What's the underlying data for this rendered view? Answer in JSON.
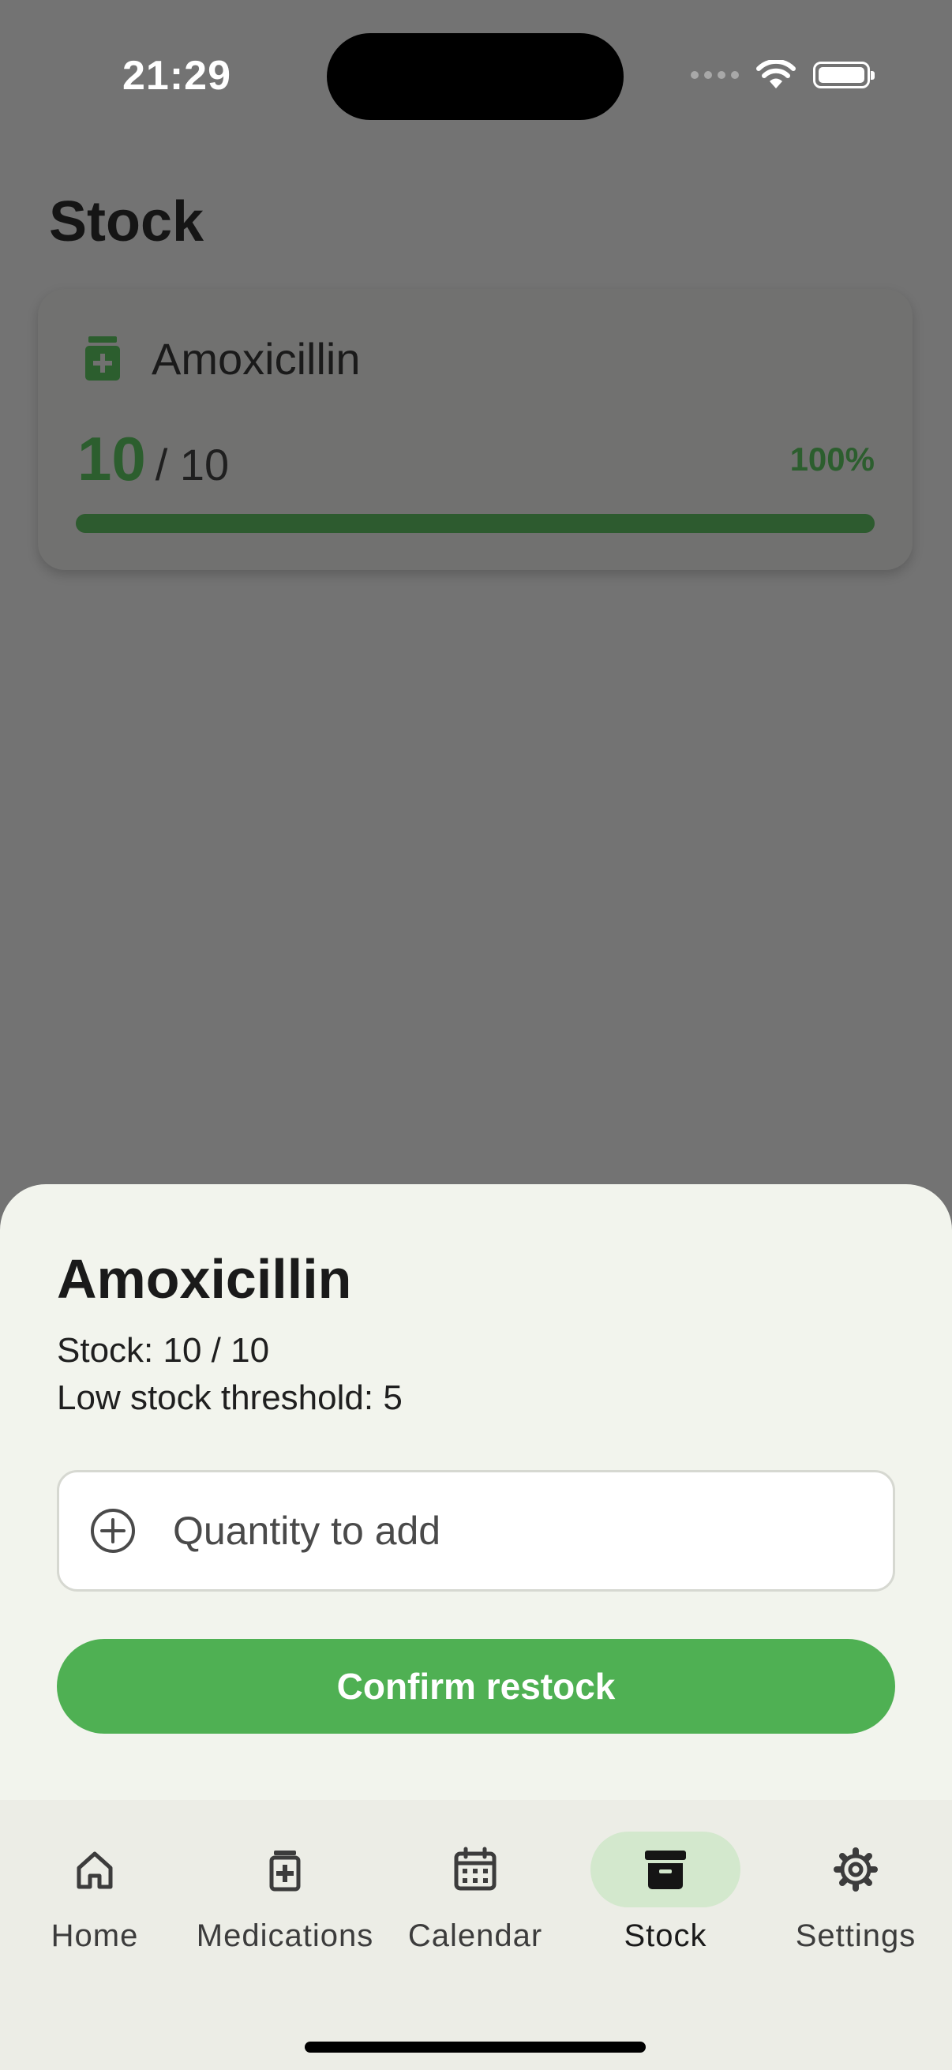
{
  "status_bar": {
    "time": "21:29"
  },
  "page": {
    "title": "Stock"
  },
  "stock_card": {
    "name": "Amoxicillin",
    "current": "10",
    "total": "/ 10",
    "percent_label": "100%",
    "fill_fraction": 1.0
  },
  "sheet": {
    "title": "Amoxicillin",
    "stock_line": "Stock: 10 / 10",
    "threshold_line": "Low stock threshold: 5",
    "quantity_placeholder": "Quantity to add",
    "confirm_label": "Confirm restock"
  },
  "nav": {
    "items": [
      {
        "label": "Home",
        "icon": "home-icon"
      },
      {
        "label": "Medications",
        "icon": "medication-icon"
      },
      {
        "label": "Calendar",
        "icon": "calendar-icon"
      },
      {
        "label": "Stock",
        "icon": "archive-icon",
        "active": true
      },
      {
        "label": "Settings",
        "icon": "gear-icon"
      }
    ]
  },
  "colors": {
    "accent": "#4fb053",
    "accent_dark": "#2c5e2e",
    "active_pill": "#d3e8cd",
    "sheet_bg": "#f2f4ed",
    "scrim": "#737373"
  }
}
